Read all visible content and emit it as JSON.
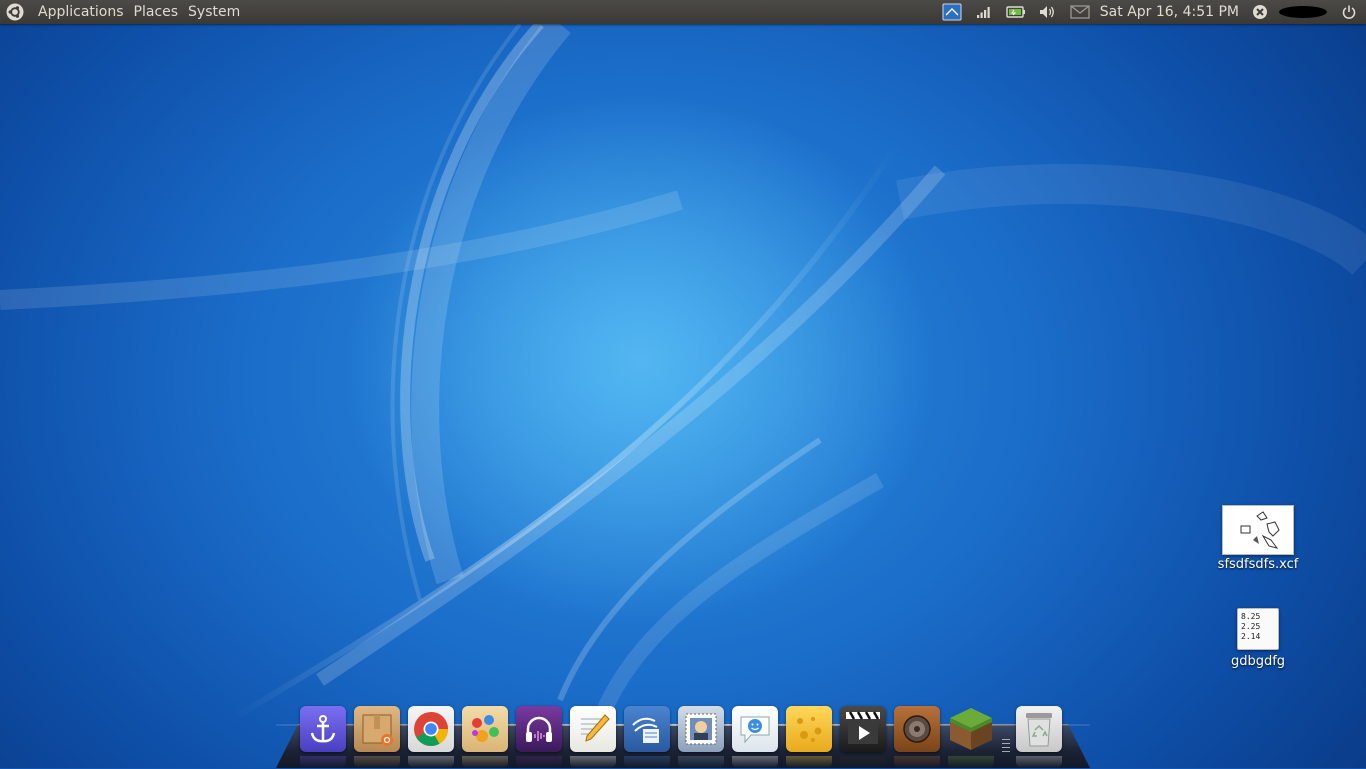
{
  "top_panel": {
    "menus": [
      "Applications",
      "Places",
      "System"
    ],
    "clock": "Sat Apr 16,  4:51 PM",
    "tray_icons": [
      "workspace-icon",
      "network-signal-icon",
      "battery-icon",
      "volume-icon",
      "mail-icon",
      "chat-status-icon",
      "power-icon"
    ]
  },
  "desktop_icons": [
    {
      "label": "sfsdfsdfs.xcf",
      "type": "xcf-image"
    },
    {
      "label": "gdbgdfg",
      "type": "text-file",
      "preview_lines": [
        "8.25",
        "2.25",
        "2.14"
      ]
    }
  ],
  "dock": {
    "items": [
      {
        "name": "dock-anchor-app",
        "color": "#5a4fd6"
      },
      {
        "name": "dock-archive-manager",
        "color": "#c89a62"
      },
      {
        "name": "dock-chrome-browser",
        "color": "#e8e8e8"
      },
      {
        "name": "dock-paint-app",
        "color": "#e8c88a"
      },
      {
        "name": "dock-music-player",
        "color": "#5a2a7a"
      },
      {
        "name": "dock-text-editor",
        "color": "#f4f4f0"
      },
      {
        "name": "dock-openoffice-writer",
        "color": "#3a6cb8"
      },
      {
        "name": "dock-mail-client",
        "color": "#6a88aa"
      },
      {
        "name": "dock-messaging-app",
        "color": "#f0f4f8"
      },
      {
        "name": "dock-cheese-camera",
        "color": "#f2c43c"
      },
      {
        "name": "dock-video-player",
        "color": "#2a2a2a"
      },
      {
        "name": "dock-speaker-app",
        "color": "#9a5a2a"
      },
      {
        "name": "dock-minecraft",
        "color": "#5a8a3a"
      },
      {
        "name": "dock-trash",
        "color": "#d8d8d8"
      }
    ]
  }
}
